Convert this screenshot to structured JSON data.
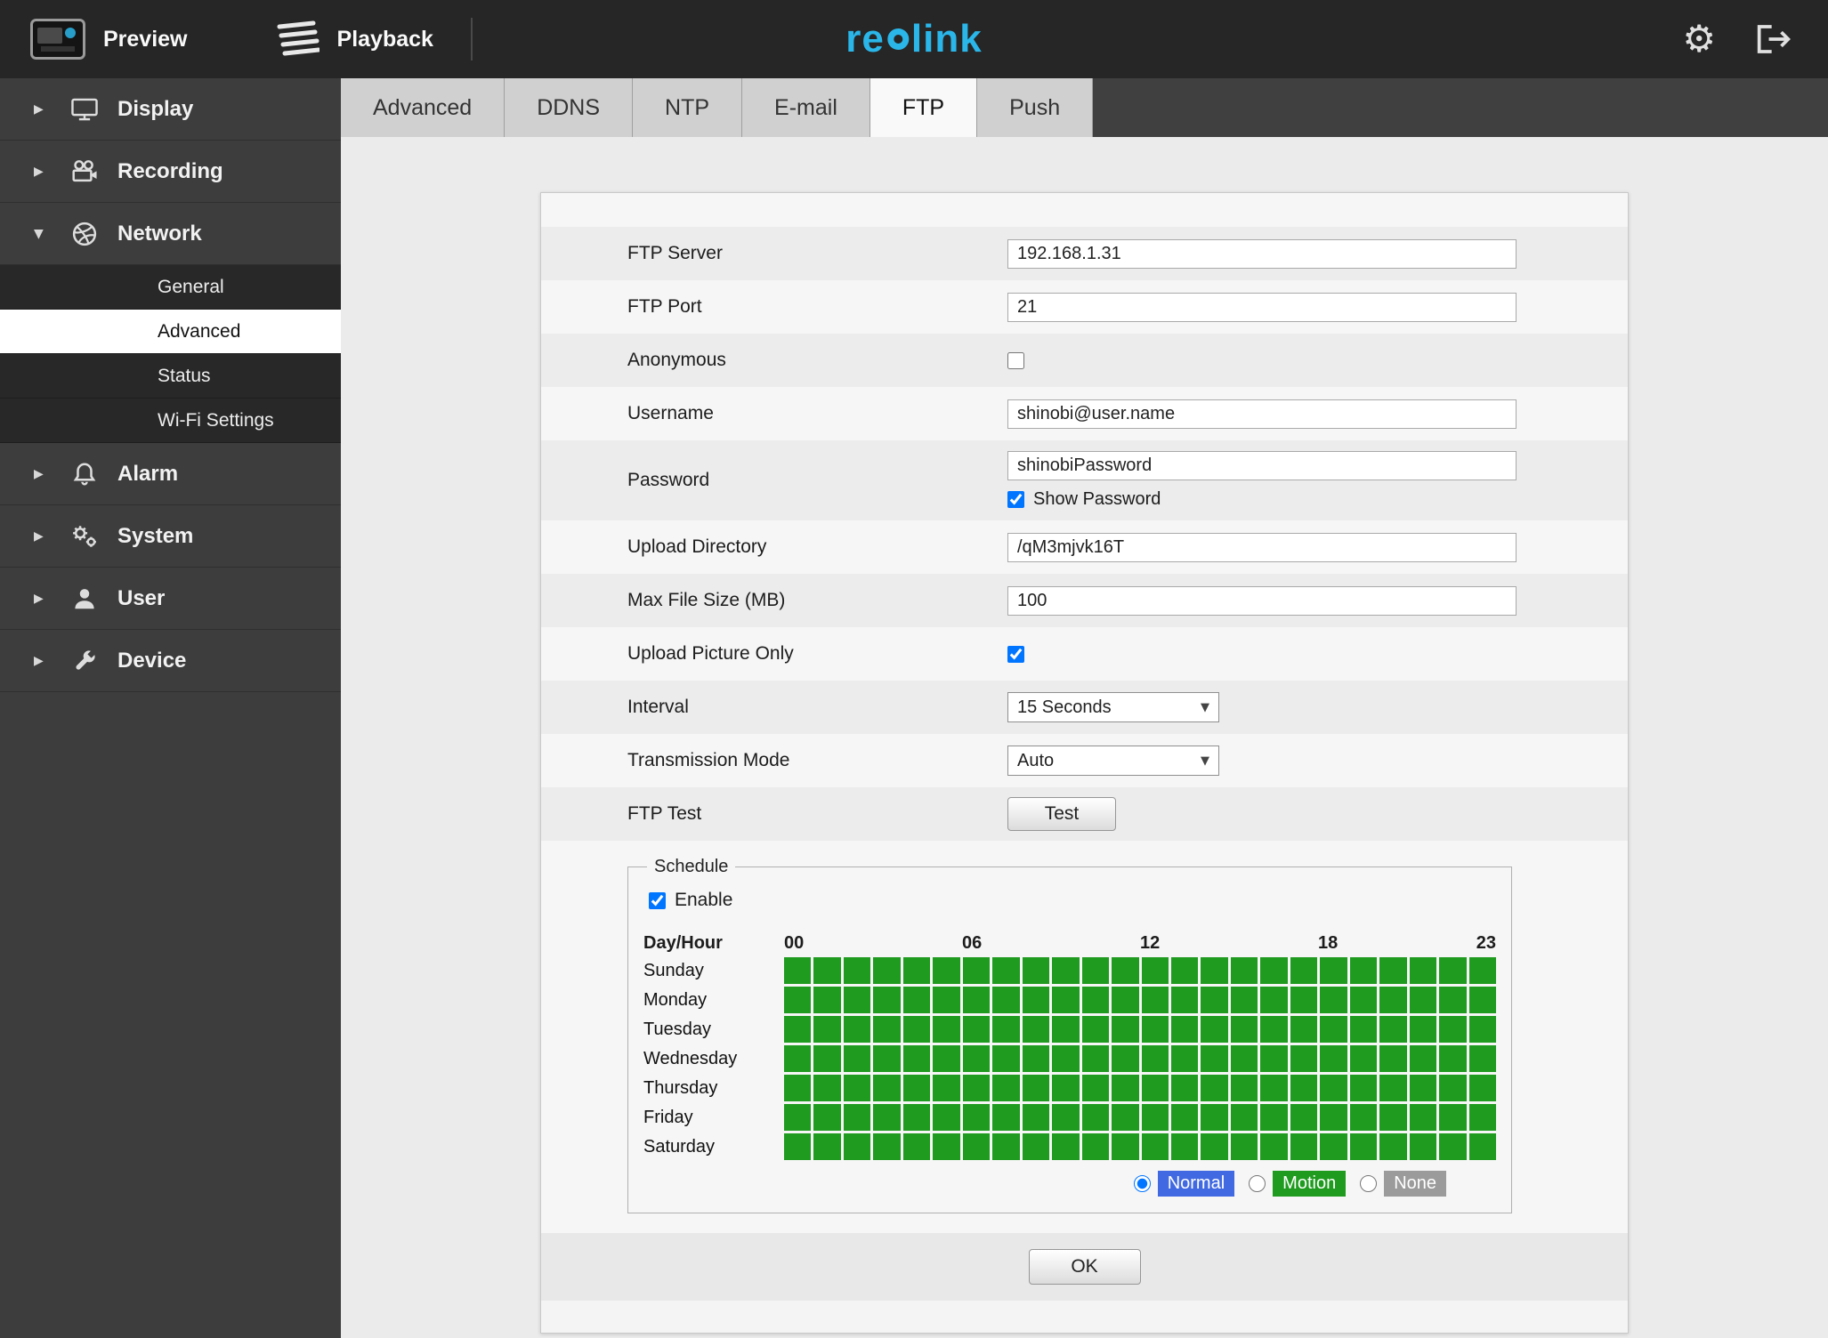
{
  "topbar": {
    "preview_label": "Preview",
    "playback_label": "Playback",
    "logo_prefix": "re",
    "logo_suffix": "link",
    "logo_color": "#2ab6e9"
  },
  "sidebar": {
    "items": [
      {
        "label": "Display",
        "icon": "monitor-icon",
        "expanded": false
      },
      {
        "label": "Recording",
        "icon": "film-camera-icon",
        "expanded": false
      },
      {
        "label": "Network",
        "icon": "network-globe-icon",
        "expanded": true
      },
      {
        "label": "Alarm",
        "icon": "bell-icon",
        "expanded": false
      },
      {
        "label": "System",
        "icon": "gears-icon",
        "expanded": false
      },
      {
        "label": "User",
        "icon": "user-icon",
        "expanded": false
      },
      {
        "label": "Device",
        "icon": "wrench-icon",
        "expanded": false
      }
    ],
    "network_children": [
      {
        "label": "General",
        "selected": false
      },
      {
        "label": "Advanced",
        "selected": true
      },
      {
        "label": "Status",
        "selected": false
      },
      {
        "label": "Wi-Fi Settings",
        "selected": false
      }
    ]
  },
  "tabs": [
    "Advanced",
    "DDNS",
    "NTP",
    "E-mail",
    "FTP",
    "Push"
  ],
  "active_tab": "FTP",
  "form": {
    "ftp_server_label": "FTP Server",
    "ftp_server_value": "192.168.1.31",
    "ftp_port_label": "FTP Port",
    "ftp_port_value": "21",
    "anonymous_label": "Anonymous",
    "anonymous_checked": false,
    "username_label": "Username",
    "username_value": "shinobi@user.name",
    "password_label": "Password",
    "password_value": "shinobiPassword",
    "show_password_label": "Show Password",
    "show_password_checked": true,
    "upload_directory_label": "Upload Directory",
    "upload_directory_value": "/qM3mjvk16T",
    "max_file_size_label": "Max File Size (MB)",
    "max_file_size_value": "100",
    "upload_picture_only_label": "Upload Picture Only",
    "upload_picture_only_checked": true,
    "interval_label": "Interval",
    "interval_value": "15 Seconds",
    "transmission_mode_label": "Transmission Mode",
    "transmission_mode_value": "Auto",
    "ftp_test_label": "FTP Test",
    "test_button_label": "Test",
    "ok_button_label": "OK"
  },
  "schedule": {
    "legend": "Schedule",
    "enable_label": "Enable",
    "enable_checked": true,
    "day_hour_label": "Day/Hour",
    "hour_labels": [
      "00",
      "06",
      "12",
      "18",
      "23"
    ],
    "hours_per_day": 24,
    "days": [
      "Sunday",
      "Monday",
      "Tuesday",
      "Wednesday",
      "Thursday",
      "Friday",
      "Saturday"
    ],
    "grid_state": "motion",
    "grid_color": "#1f9b1f",
    "modes": [
      {
        "label": "Normal",
        "color": "#4169e1",
        "selected": true
      },
      {
        "label": "Motion",
        "color": "#1f9b1f",
        "selected": false
      },
      {
        "label": "None",
        "color": "#9b9b9b",
        "selected": false
      }
    ]
  }
}
